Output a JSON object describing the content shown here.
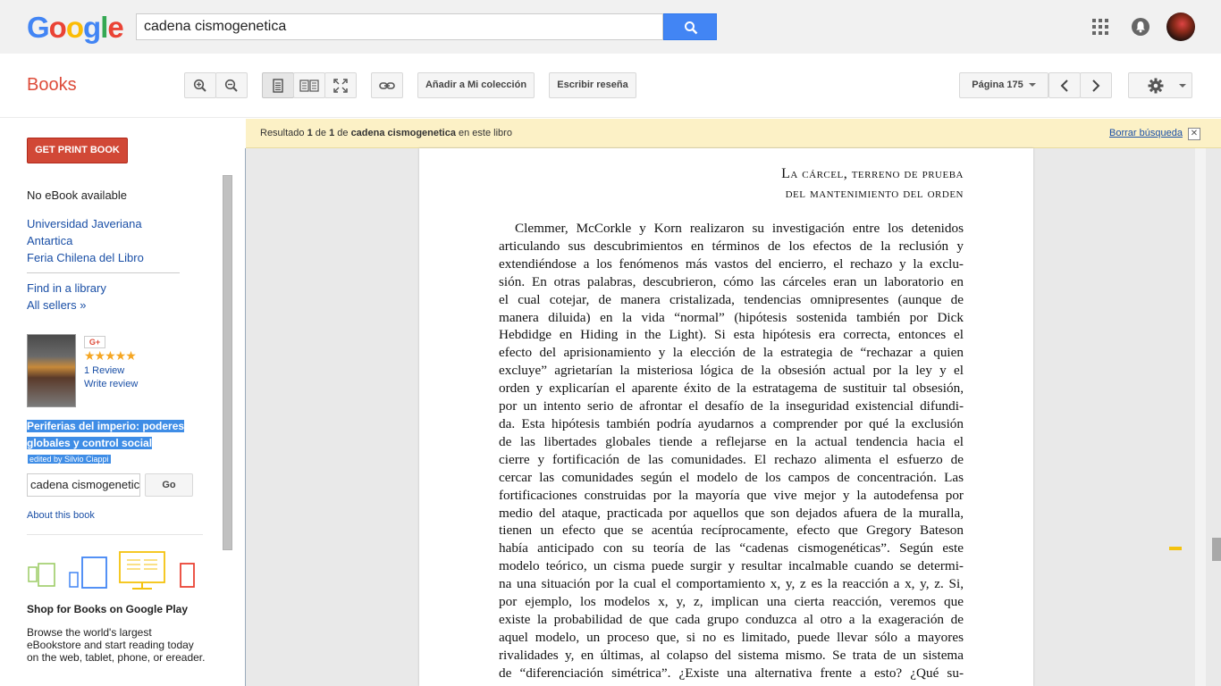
{
  "google": {
    "logo": [
      "G",
      "o",
      "o",
      "g",
      "l",
      "e"
    ],
    "logo_colors": [
      "#4285f4",
      "#ea4335",
      "#fbbc05",
      "#4285f4",
      "#34a853",
      "#ea4335"
    ],
    "search_value": "cadena cismogenetica"
  },
  "toolbar": {
    "title": "Books",
    "add_collection": "Añadir a Mi colección",
    "write_review": "Escribir reseña",
    "page_label": "Página 175"
  },
  "sidebar": {
    "print_button": "GET PRINT BOOK",
    "no_ebook": "No eBook available",
    "sellers": [
      "Universidad Javeriana",
      "Antartica",
      "Feria Chilena del Libro"
    ],
    "find_library": "Find in a library",
    "all_sellers": "All sellers »",
    "gplus": "G+",
    "stars": "★★★★★",
    "review_count": "1 Review",
    "write_review": "Write review",
    "book_title_1": "Periferias del imperio: poderes",
    "book_title_2": "globales y control social",
    "editor": "edited by Silvio Ciappi",
    "in_book_search": "cadena cismogenetica",
    "go_button": "Go",
    "about": "About this book",
    "play_title": "Shop for Books on Google Play",
    "play_desc": "Browse the world's largest eBookstore and start reading today on the web, tablet, phone, or ereader."
  },
  "banner": {
    "prefix": "Resultado ",
    "n1": "1",
    "mid": " de ",
    "n2": "1",
    "mid2": " de ",
    "query": "cadena cismogenetica",
    "suffix": " en este libro",
    "clear": "Borrar búsqueda",
    "close": "✕"
  },
  "page": {
    "heading_1": "La cárcel, terreno de prueba",
    "heading_2": "del mantenimiento del orden",
    "lines": [
      "Clemmer, McCorkle y Korn realizaron su investigación entre los detenidos",
      "articulando sus descubrimientos en términos de los efectos de la reclusión y",
      "extendiéndose a los fenómenos más vastos del encierro, el rechazo y la exclu-",
      "sión. En otras palabras, descubrieron, cómo las cárceles eran un laboratorio en",
      "el cual cotejar, de manera cristalizada, tendencias omnipresentes (aunque de",
      "manera diluida) en la vida “normal” (hipótesis sostenida también por Dick",
      "Hebdidge en Hiding in the Light). Si esta hipótesis era correcta, entonces el",
      "efecto del aprisionamiento y la elección de la estrategia de “rechazar a quien",
      "excluye” agrietarían la misteriosa lógica de la obsesión actual por la ley y el",
      "orden y explicarían el aparente éxito de la estratagema de sustituir tal obsesión,",
      "por un intento serio de afrontar el desafío de la inseguridad existencial difundi-",
      "da. Esta hipótesis también podría ayudarnos a comprender por qué la exclusión",
      "de las libertades globales tiende a reflejarse en la actual tendencia hacia el",
      "cierre y fortificación de las comunidades. El rechazo alimenta el esfuerzo de",
      "cercar las comunidades según el modelo de los campos de concentración. Las",
      "fortificaciones construidas por la mayoría que vive mejor y la autodefensa por",
      "medio del ataque, practicada por aquellos que son dejados afuera de la muralla,",
      "tienen un efecto que se acentúa recíprocamente, efecto que Gregory Bateson",
      "había anticipado con su teoría de las “cadenas cismogenéticas”. Según este",
      "modelo teórico, un cisma puede surgir y resultar incalmable cuando se determi-",
      "na una situación por la cual el comportamiento x, y, z es la reacción a x, y, z. Si,",
      "por ejemplo, los modelos x, y, z, implican una cierta reacción, veremos que",
      "existe la probabilidad de que cada grupo conduzca al otro a la exageración de",
      "aquel modelo, un proceso que, si no es limitado, puede llevar sólo a mayores",
      "rivalidades y, en últimas, al colapso del sistema mismo. Se trata de un sistema",
      "de “diferenciación simétrica”. ¿Existe una alternativa frente a esto? ¿Qué su-"
    ]
  }
}
